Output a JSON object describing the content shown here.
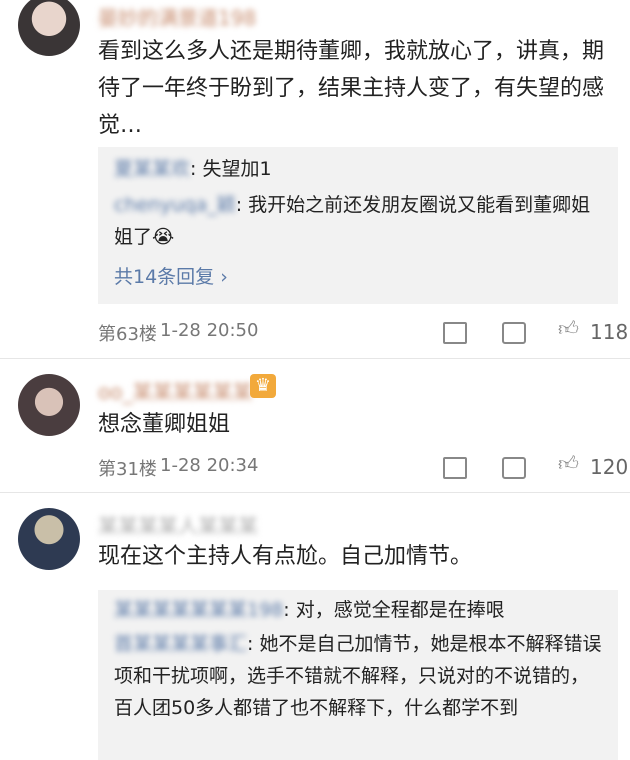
{
  "comments": [
    {
      "username": "晏妙的满景道198",
      "text": "看到这么多人还是期待董卿，我就放心了，讲真，期待了一年终于盼到了，结果主持人变了，有失望的感觉…",
      "replies": [
        {
          "name": "夏某某欢",
          "text": ": 失望加1"
        },
        {
          "name": "chenyuqa_颖",
          "text": ": 我开始之前还发朋友圈说又能看到董卿姐姐了😭"
        }
      ],
      "more_replies": "共14条回复 ›",
      "floor": "第63楼",
      "time": "1-28 20:50",
      "likes": "118"
    },
    {
      "username": "oo_某某某某某某",
      "crown_icon": "crown-icon",
      "text": "想念董卿姐姐",
      "floor": "第31楼",
      "time": "1-28 20:34",
      "likes": "120"
    },
    {
      "username": "某某某某人某某某",
      "text": "现在这个主持人有点尬。自己加情节。",
      "replies": [
        {
          "name": "某某某某某某某198",
          "text": ": 对，感觉全程都是在捧哏"
        },
        {
          "name": "首某某某某事汇",
          "text": ": 她不是自己加情节，她是根本不解释错误项和干扰项啊，选手不错就不解释，只说对的不说错的，百人团50多人都错了也不解释下，什么都学不到"
        }
      ]
    }
  ],
  "colors": {
    "link": "#5b7aa8",
    "reply_bg": "#f2f2f2",
    "username": "#c78c6e"
  }
}
